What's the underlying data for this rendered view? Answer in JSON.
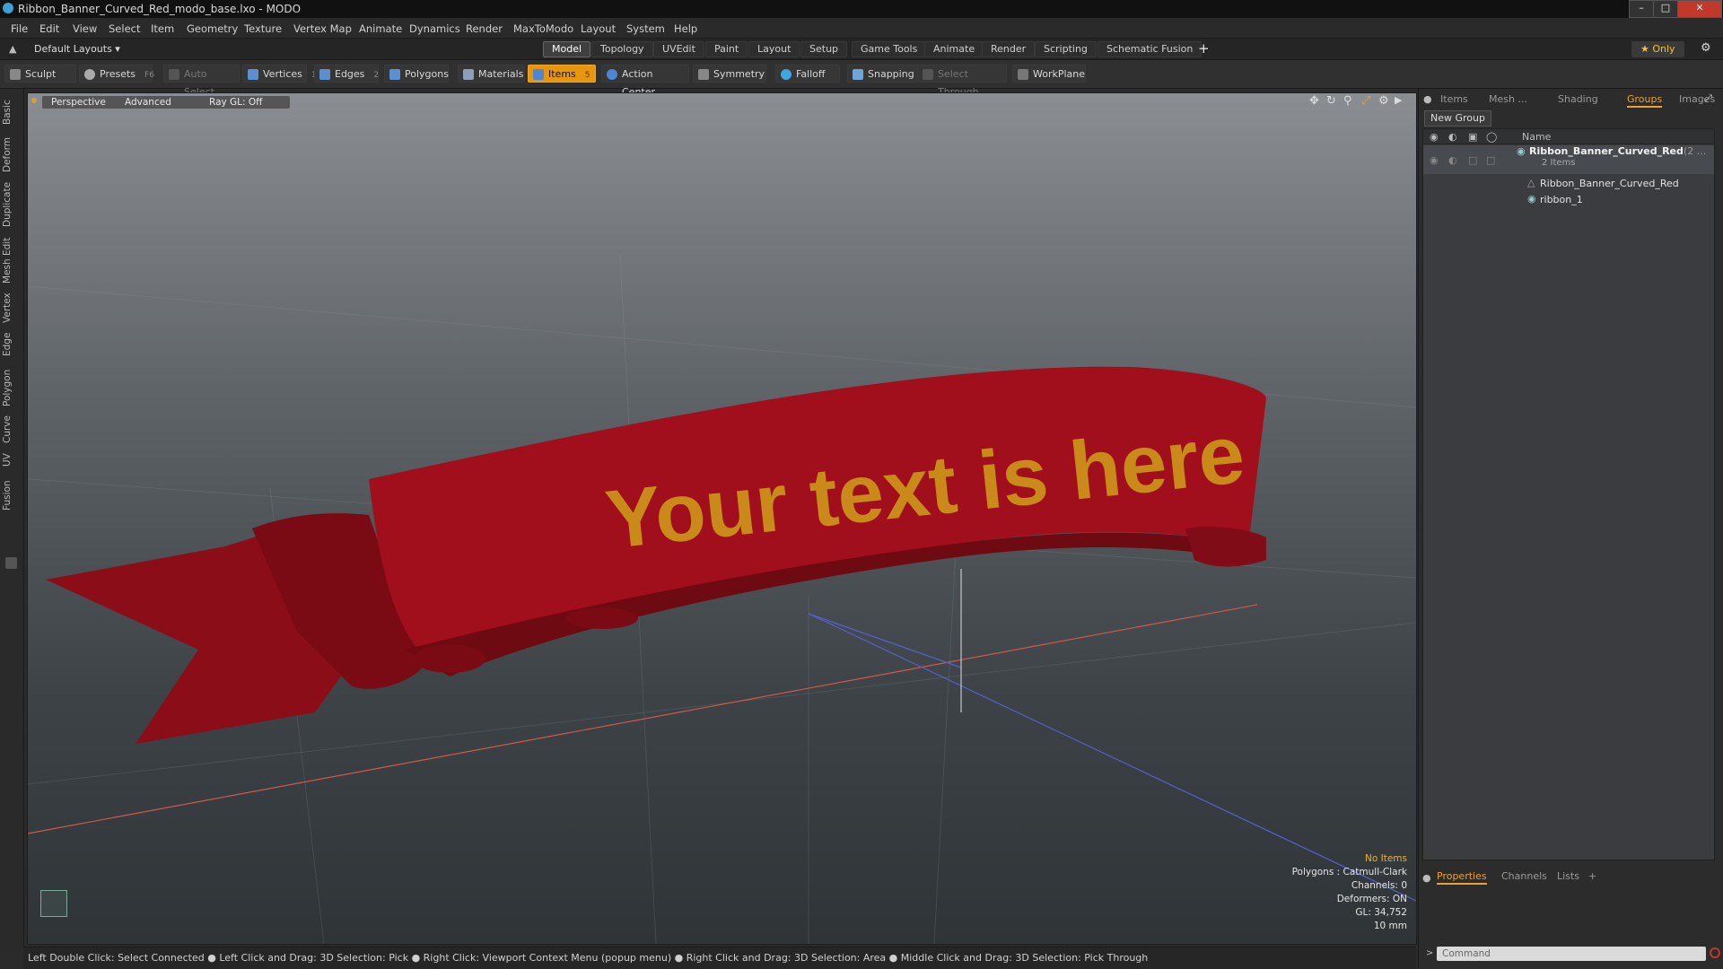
{
  "window": {
    "title": "Ribbon_Banner_Curved_Red_modo_base.lxo - MODO",
    "buttons": [
      "–",
      "□",
      "✕"
    ]
  },
  "menu": [
    "File",
    "Edit",
    "View",
    "Select",
    "Item",
    "Geometry",
    "Texture",
    "Vertex Map",
    "Animate",
    "Dynamics",
    "Render",
    "MaxToModo",
    "Layout",
    "System",
    "Help"
  ],
  "layoutbar": {
    "layouts_label": "Default Layouts ▾",
    "tabs": [
      "Model",
      "Topology",
      "UVEdit",
      "Paint",
      "Layout",
      "Setup",
      "Game Tools",
      "Animate",
      "Render",
      "Scripting",
      "Schematic Fusion"
    ],
    "active_tab": "Model",
    "add": "+",
    "only_label": "★  Only",
    "gear": "⚙"
  },
  "toolbar": {
    "sculpt": "Sculpt",
    "presets": "Presets",
    "presets_key": "F6",
    "auto_select": "Auto Select",
    "vertices": "Vertices",
    "vertices_key": "1",
    "edges": "Edges",
    "edges_key": "2",
    "polygons": "Polygons",
    "materials": "Materials",
    "items": "Items",
    "items_key": "5",
    "action_center": "Action Center",
    "symmetry": "Symmetry",
    "falloff": "Falloff",
    "snapping": "Snapping",
    "select_through": "Select Through",
    "workplane": "WorkPlane"
  },
  "sidetabs": [
    "Basic",
    "Deform",
    "Duplicate",
    "Mesh Edit",
    "Vertex",
    "Edge",
    "Polygon",
    "Curve",
    "UV",
    "Fusion"
  ],
  "viewport": {
    "perspective": "Perspective",
    "advanced": "Advanced",
    "raygl": "Ray GL: Off",
    "banner_text": "Your text is here",
    "info": {
      "no_items": "No Items",
      "polygons": "Polygons : Catmull-Clark",
      "channels": "Channels: 0",
      "deformers": "Deformers: ON",
      "gl": "GL: 34,752",
      "scale": "10 mm"
    },
    "colors": {
      "ribbon": "#a10f1c",
      "ribbon_dark": "#6e0a12",
      "text": "#c98a1a"
    }
  },
  "status": "Left Double Click: Select Connected ● Left Click and Drag: 3D Selection: Pick ● Right Click: Viewport Context Menu (popup menu) ● Right Click and Drag: 3D Selection: Area ● Middle Click and Drag: 3D Selection: Pick Through",
  "rightpanel": {
    "tabs": [
      "Items",
      "Mesh ...",
      "Shading",
      "Groups",
      "Images"
    ],
    "active_tab": "Groups",
    "new_group": "New Group",
    "col_name": "Name",
    "group": {
      "name": "Ribbon_Banner_Curved_Red",
      "suffix": "(2 ...",
      "count": "2 Items",
      "children": [
        "Ribbon_Banner_Curved_Red",
        "ribbon_1"
      ]
    },
    "bottom_tabs": [
      "Properties",
      "Channels",
      "Lists"
    ],
    "bottom_active": "Properties",
    "bottom_add": "+",
    "command_placeholder": "Command"
  }
}
